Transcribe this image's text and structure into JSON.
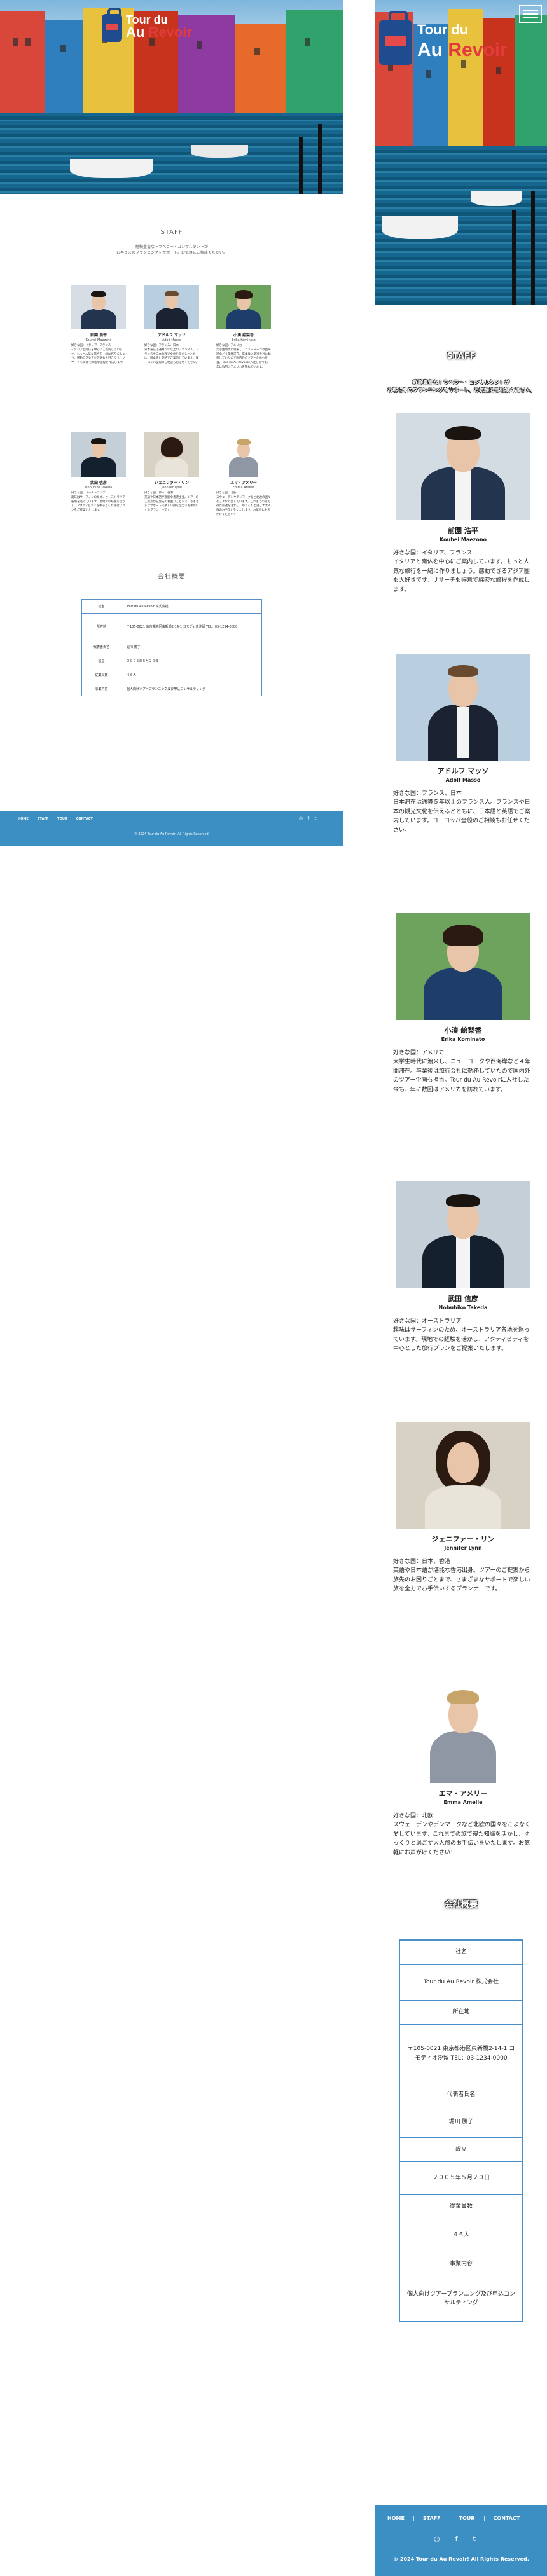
{
  "logo": {
    "line1": "Tour du",
    "line2a": "Au ",
    "line2b": "Revoir"
  },
  "staff": {
    "title": "STAFF",
    "subtitle_line1": "経験豊富なトラベラー・コンサルタントが",
    "subtitle_line2": "お客さまのブランニングをサポート。お気軽にご相談ください。",
    "members": [
      {
        "name": "前園 浩平",
        "en": "Kouhei Maezono",
        "bio": "好きな国：イタリア、フランス\nイタリアと南仏を中心にご案内しています。もっと人気な旅行を一緒に作りましょう。感動できるアジア圏も大好きです。リサーチも得意で綿密な旅程を作成します。"
      },
      {
        "name": "アドルフ マッソ",
        "en": "Adolf Masso",
        "bio": "好きな国：フランス、日本\n日本滞在は通算５年以上のフランス人。フランスや日本の観光文化を伝えるとともに、日本語と英語でご案内しています。ヨーロッパ全般のご相談もお任せください。"
      },
      {
        "name": "小湊 絵梨香",
        "en": "Erika Kominato",
        "bio": "好きな国：アメリカ\n大学生時代に渡米し、ニューヨークや西海岸など４年間滞在。卒業後は旅行会社に勤務していたので国内外のツアー企画も担当。Tour du Au Revoirに入社した今も、年に数回はアメリカを訪れています。"
      },
      {
        "name": "武田 信彦",
        "en": "Nobuhiko Takeda",
        "bio": "好きな国：オーストラリア\n趣味はサーフィンのため、オーストラリア各地を巡っています。現地での経験を活かし、アクティビティを中心とした旅行プランをご提案いたします。"
      },
      {
        "name": "ジェニファー・リン",
        "en": "Jennifer Lynn",
        "bio": "好きな国：日本、香港\n英語や日本語が堪能な香港出身。ツアーのご提案から旅先のお困りごとまで、さまざまなサポートで楽しい旅を全力でお手伝いするプランナーです。"
      },
      {
        "name": "エマ・アメリー",
        "en": "Emma Amelie",
        "bio": "好きな国：北欧\nスウェーデンやデンマークなど北欧の国々をこよなく愛しています。これまでの旅で得た知識を活かし、ゆっくりと過ごす大人旅のお手伝いをいたします。お気軽にお声がけください！"
      }
    ]
  },
  "company": {
    "title": "会社概要",
    "rows": [
      {
        "label": "社名",
        "value": "Tour du Au Revoir 株式会社"
      },
      {
        "label": "所在地",
        "value": "〒105-0021 東京都港区東新橋2-14-1 コモディオ汐留 TEL：03-1234-0000"
      },
      {
        "label": "代表者氏名",
        "value": "堀川 勝子"
      },
      {
        "label": "設立",
        "value": "２００５年５月２０日"
      },
      {
        "label": "従業員数",
        "value": "４６人"
      },
      {
        "label": "事業内容",
        "value": "個人向けツアープランニング及び申込コンサルティング"
      }
    ]
  },
  "footer": {
    "nav": [
      "HOME",
      "STAFF",
      "TOUR",
      "CONTACT"
    ],
    "icons": [
      "instagram-icon",
      "facebook-icon",
      "twitter-icon"
    ],
    "icon_glyphs": [
      "◎",
      "f",
      "t"
    ],
    "copyright": "© 2024 Tour du Au Revoir! All Rights Reserved."
  },
  "colors": {
    "accent": "#3c8fc2",
    "logo_red": "#e23b3b",
    "logo_blue": "#1e4c8f",
    "table_border": "#4b8fc8"
  }
}
